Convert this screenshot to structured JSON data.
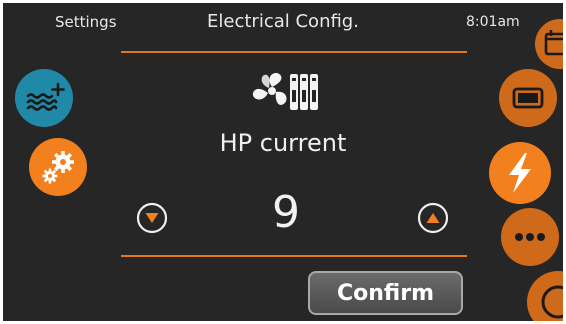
{
  "header": {
    "left_label": "Settings",
    "title": "Electrical Config.",
    "time": "8:01am"
  },
  "parameter": {
    "icon": "fan-heatpump-icon",
    "label": "HP current",
    "value": "9"
  },
  "controls": {
    "decrease_icon": "arrow-down-icon",
    "increase_icon": "arrow-up-icon",
    "confirm_label": "Confirm"
  },
  "left_nav": [
    {
      "icon": "water-heat-icon",
      "color": "#2189a8"
    },
    {
      "icon": "gears-icon",
      "color": "#f2801f"
    }
  ],
  "right_nav": [
    {
      "icon": "calendar-icon",
      "color": "#cf6a1a"
    },
    {
      "icon": "display-icon",
      "color": "#cf6a1a"
    },
    {
      "icon": "lightning-icon",
      "color": "#f2801f",
      "selected": true
    },
    {
      "icon": "more-icon",
      "color": "#cf6a1a"
    },
    {
      "icon": "power-icon",
      "color": "#cf6a1a"
    }
  ],
  "colors": {
    "background": "#262626",
    "accent": "#e2771f",
    "accent_selected": "#f2801f",
    "text": "#e8e8e8"
  }
}
